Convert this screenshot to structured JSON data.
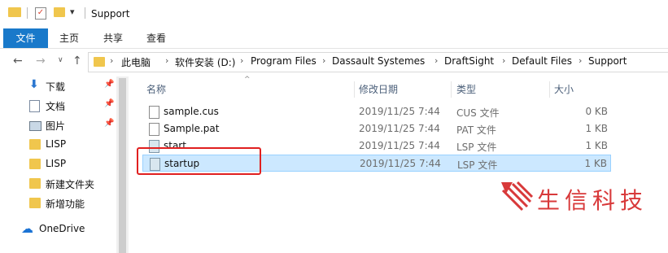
{
  "window": {
    "title": "Support"
  },
  "ribbon": {
    "tabs": [
      "文件",
      "主页",
      "共享",
      "查看"
    ]
  },
  "address": {
    "crumbs": [
      "此电脑",
      "软件安装 (D:)",
      "Program Files",
      "Dassault Systemes",
      "DraftSight",
      "Default Files",
      "Support"
    ]
  },
  "sidebar": {
    "items": [
      {
        "label": "下载",
        "icon": "download-icon",
        "pinned": true
      },
      {
        "label": "文档",
        "icon": "document-icon",
        "pinned": true
      },
      {
        "label": "图片",
        "icon": "picture-icon",
        "pinned": true
      },
      {
        "label": "LISP",
        "icon": "folder-icon",
        "pinned": false
      },
      {
        "label": "LISP",
        "icon": "folder-icon",
        "pinned": false
      },
      {
        "label": "新建文件夹",
        "icon": "folder-icon",
        "pinned": false
      },
      {
        "label": "新增功能",
        "icon": "folder-icon",
        "pinned": false
      },
      {
        "label": "OneDrive",
        "icon": "cloud-icon",
        "pinned": false
      }
    ]
  },
  "columns": {
    "name": "名称",
    "date": "修改日期",
    "type": "类型",
    "size": "大小"
  },
  "files": [
    {
      "name": "sample.cus",
      "date": "2019/11/25 7:44",
      "type": "CUS 文件",
      "size": "0 KB",
      "selected": false
    },
    {
      "name": "Sample.pat",
      "date": "2019/11/25 7:44",
      "type": "PAT 文件",
      "size": "1 KB",
      "selected": false
    },
    {
      "name": "start",
      "date": "2019/11/25 7:44",
      "type": "LSP 文件",
      "size": "1 KB",
      "selected": false
    },
    {
      "name": "startup",
      "date": "2019/11/25 7:44",
      "type": "LSP 文件",
      "size": "1 KB",
      "selected": true
    }
  ],
  "watermark": {
    "text": "生信科技",
    "color": "#d8393a"
  },
  "colors": {
    "accent": "#1979ca",
    "selection": "#cce8ff",
    "highlight_box": "#e02020"
  }
}
